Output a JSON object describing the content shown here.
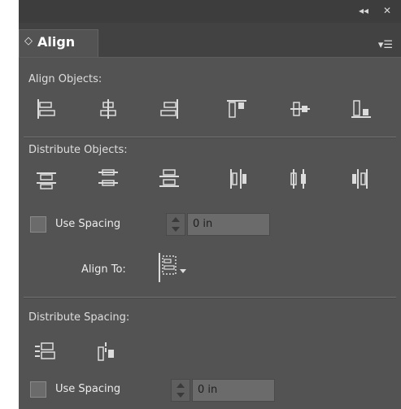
{
  "window": {
    "collapse_glyph": "◂◂",
    "close_glyph": "✕"
  },
  "panel": {
    "tab_title": "Align",
    "tab_chevron_glyph": "◇",
    "menu_glyph": "▾☰"
  },
  "align_objects": {
    "label": "Align Objects:",
    "buttons": [
      "align-left-edges-icon",
      "align-horizontal-centers-icon",
      "align-right-edges-icon",
      "align-top-edges-icon",
      "align-vertical-centers-icon",
      "align-bottom-edges-icon"
    ]
  },
  "distribute_objects": {
    "label": "Distribute Objects:",
    "buttons": [
      "distribute-top-edges-icon",
      "distribute-vertical-centers-icon",
      "distribute-bottom-edges-icon",
      "distribute-left-edges-icon",
      "distribute-horizontal-centers-icon",
      "distribute-right-edges-icon"
    ],
    "use_spacing_label": "Use Spacing",
    "use_spacing_checked": false,
    "spacing_value": "0 in"
  },
  "align_to": {
    "label": "Align To:",
    "icon": "align-to-selection-icon"
  },
  "distribute_spacing": {
    "label": "Distribute Spacing:",
    "buttons": [
      "distribute-vertical-space-icon",
      "distribute-horizontal-space-icon"
    ],
    "use_spacing_label": "Use Spacing",
    "use_spacing_checked": false,
    "spacing_value": "0 in"
  },
  "colors": {
    "panel_bg": "#535353",
    "titlebar_bg": "#3d3d3d",
    "text": "#dedede",
    "icon": "#dcdcdc"
  }
}
